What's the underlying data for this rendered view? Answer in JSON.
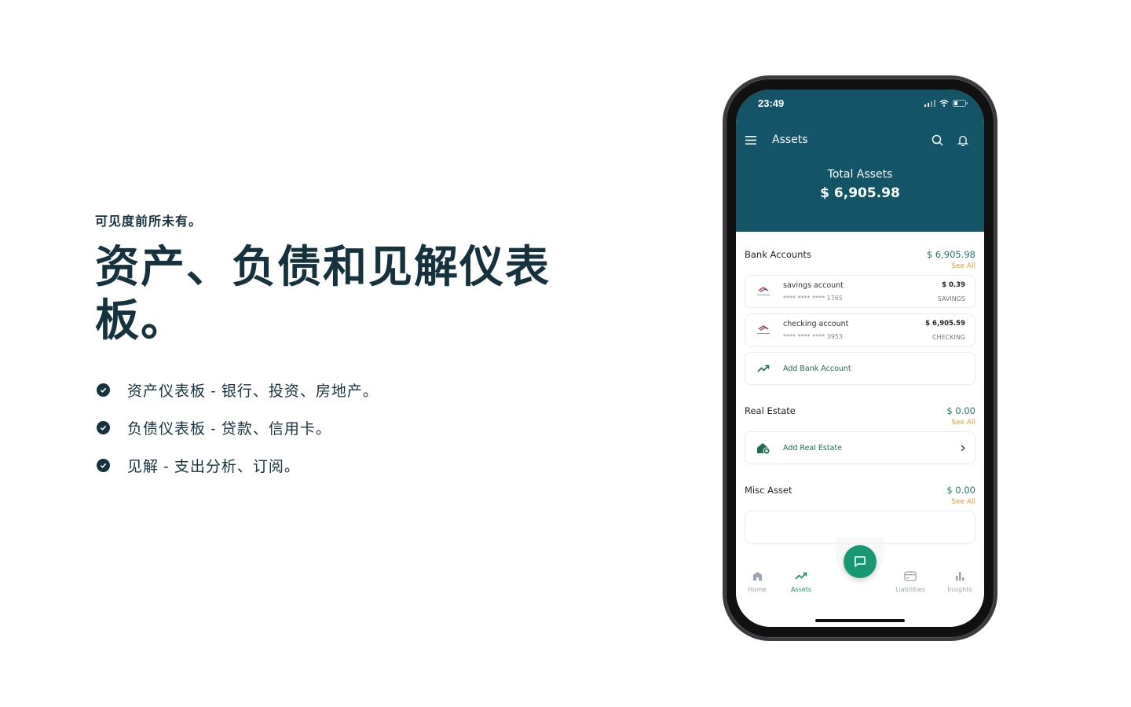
{
  "marketing": {
    "eyebrow": "可见度前所未有。",
    "headline": "资产、负债和见解仪表板。",
    "features": [
      "资产仪表板 - 银行、投资、房地产。",
      "负债仪表板 - 贷款、信用卡。",
      "见解 - 支出分析、订阅。"
    ]
  },
  "phone": {
    "status": {
      "time": "23:49"
    },
    "appbar": {
      "title": "Assets"
    },
    "total": {
      "label": "Total Assets",
      "value": "$ 6,905.98"
    },
    "sections": {
      "bank": {
        "title": "Bank Accounts",
        "amount": "$ 6,905.98",
        "see_all": "See All",
        "accounts": [
          {
            "name": "savings account",
            "mask": "**** **** **** 1765",
            "amount": "$ 0.39",
            "type": "SAVINGS"
          },
          {
            "name": "checking account",
            "mask": "**** **** **** 3953",
            "amount": "$ 6,905.59",
            "type": "CHECKING"
          }
        ],
        "add_label": "Add Bank Account"
      },
      "real_estate": {
        "title": "Real Estate",
        "amount": "$ 0.00",
        "see_all": "See All",
        "add_label": "Add Real Estate"
      },
      "misc": {
        "title": "Misc Asset",
        "amount": "$ 0.00",
        "see_all": "See All"
      }
    },
    "tabs": [
      {
        "label": "Home",
        "icon": "home-icon"
      },
      {
        "label": "Assets",
        "icon": "trending-up-icon",
        "active": true
      },
      {
        "label": "Liabilities",
        "icon": "credit-card-icon"
      },
      {
        "label": "Insights",
        "icon": "bar-chart-icon"
      }
    ],
    "colors": {
      "header": "#135466",
      "accent": "#179872",
      "see_all": "#e89a2a"
    }
  }
}
